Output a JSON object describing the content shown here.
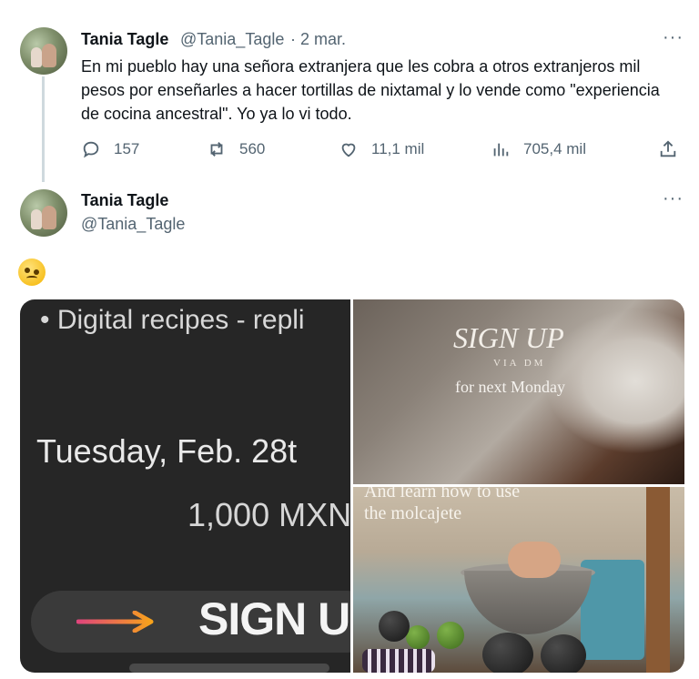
{
  "tweet1": {
    "name": "Tania Tagle",
    "handle": "@Tania_Tagle",
    "separator": "·",
    "date": "2 mar.",
    "more": "···",
    "text": "En mi pueblo hay una señora extranjera que les cobra a otros extranjeros mil pesos por enseñarles a hacer tortillas de nixtamal y lo vende como \"experiencia de cocina ancestral\". Yo ya lo vi todo.",
    "actions": {
      "replies": "157",
      "retweets": "560",
      "likes": "11,1 mil",
      "views": "705,4 mil"
    }
  },
  "tweet2": {
    "name": "Tania Tagle",
    "handle": "@Tania_Tagle",
    "more": "···",
    "emoji": "woozy-face",
    "media": {
      "left": {
        "digital": "• Digital recipes - repli",
        "date": "Tuesday, Feb. 28t",
        "price": "1,000 MXN",
        "signup": "SIGN UP"
      },
      "right_top": {
        "signup": "SIGN UP",
        "via": "VIA DM",
        "next": "for next Monday"
      },
      "right_bottom": {
        "line1": "And learn how to use",
        "line2": "the molcajete"
      }
    }
  },
  "colors": {
    "text": "#0f1419",
    "secondary": "#536471",
    "thread_line": "#cfd9de"
  }
}
